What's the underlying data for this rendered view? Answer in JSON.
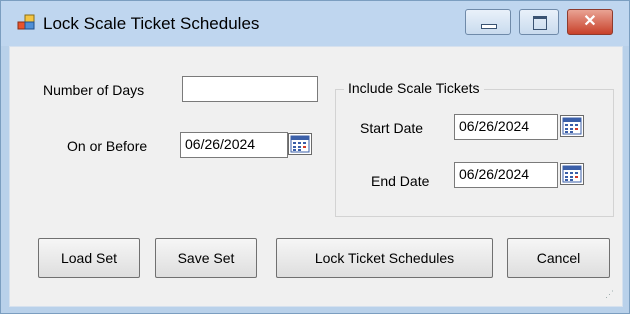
{
  "window": {
    "title": "Lock Scale Ticket Schedules",
    "close_glyph": "✕"
  },
  "form": {
    "number_of_days_label": "Number of Days",
    "number_of_days_value": "",
    "on_or_before_label": "On or Before",
    "on_or_before_value": "06/26/2024",
    "include_group_title": "Include Scale Tickets",
    "start_date_label": "Start Date",
    "start_date_value": "06/26/2024",
    "end_date_label": "End Date",
    "end_date_value": "06/26/2024"
  },
  "buttons": {
    "load_set": "Load Set",
    "save_set": "Save Set",
    "lock_ticket_schedules": "Lock Ticket Schedules",
    "cancel": "Cancel"
  },
  "icons": {
    "app": "form-icon",
    "calendar": "calendar-icon",
    "minimize": "minimize-icon",
    "maximize": "maximize-icon",
    "close": "close-icon"
  }
}
